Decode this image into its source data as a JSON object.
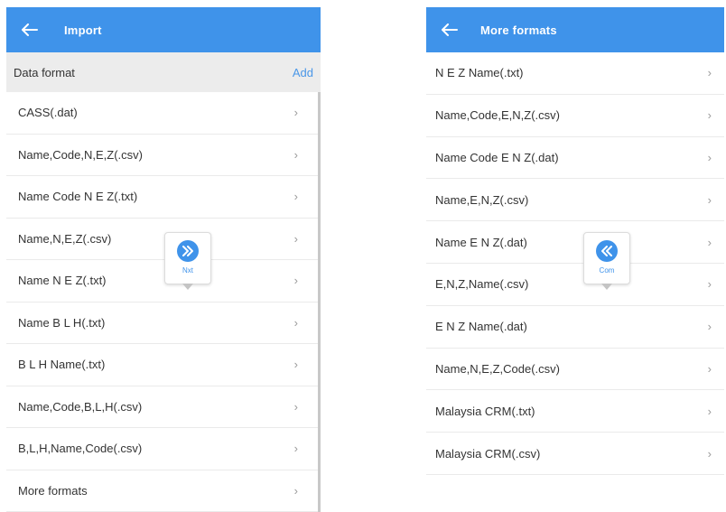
{
  "left": {
    "header_title": "Import",
    "subheader_label": "Data format",
    "add_label": "Add",
    "items": [
      "CASS(.dat)",
      "Name,Code,N,E,Z(.csv)",
      "Name Code N E Z(.txt)",
      "Name,N,E,Z(.csv)",
      "Name N E Z(.txt)",
      "Name B L H(.txt)",
      "B L H Name(.txt)",
      "Name,Code,B,L,H(.csv)",
      "B,L,H,Name,Code(.csv)",
      "More formats"
    ],
    "floating_button_label": "Nxt"
  },
  "right": {
    "header_title": "More formats",
    "items": [
      "N E Z Name(.txt)",
      "Name,Code,E,N,Z(.csv)",
      "Name Code E N Z(.dat)",
      "Name,E,N,Z(.csv)",
      "Name E N Z(.dat)",
      "E,N,Z,Name(.csv)",
      "E N Z Name(.dat)",
      "Name,N,E,Z,Code(.csv)",
      "Malaysia CRM(.txt)",
      "Malaysia CRM(.csv)"
    ],
    "floating_button_label": "Com"
  },
  "chevron": "›",
  "colors": {
    "header": "#3f93ea",
    "subheader": "#ececec",
    "link": "#4a97e8"
  },
  "icons": {
    "back": "back-arrow-icon",
    "next": "double-chevron-right-icon",
    "compare": "double-chevron-left-icon",
    "row": "chevron-right-icon"
  }
}
